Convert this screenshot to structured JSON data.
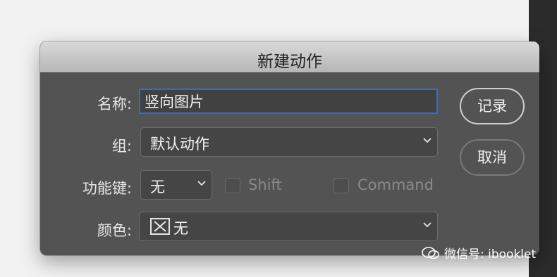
{
  "dialog": {
    "title": "新建动作"
  },
  "form": {
    "name_label": "名称:",
    "name_value": "竖向图片",
    "group_label": "组:",
    "group_value": "默认动作",
    "fkey_label": "功能键:",
    "fkey_value": "无",
    "shift_label": "Shift",
    "command_label": "Command",
    "color_label": "颜色:",
    "color_value": "无"
  },
  "buttons": {
    "record": "记录",
    "cancel": "取消"
  },
  "watermark": {
    "text": "微信号: ibooklet"
  },
  "colors": {
    "focus_ring": "#2f6fd1",
    "dialog_bg": "#535353",
    "titlebar": "#c8c8c8"
  }
}
